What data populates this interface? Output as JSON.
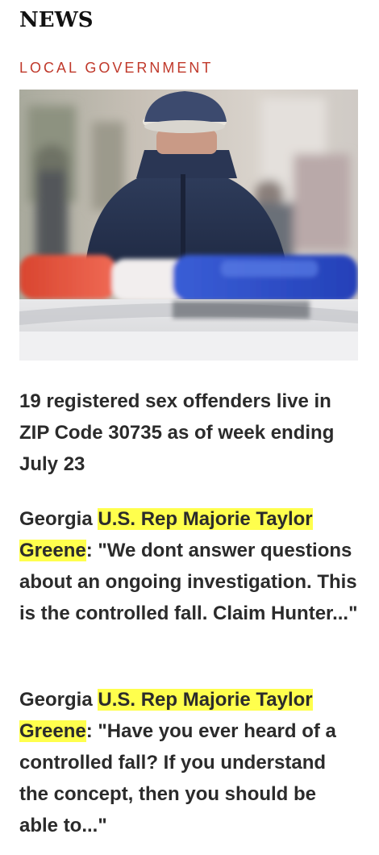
{
  "section": {
    "title": "NEWS",
    "category": "LOCAL GOVERNMENT"
  },
  "hero_image": {
    "icon": "police-officer-lightbar-photo"
  },
  "articles": [
    {
      "headline": "19 registered sex offenders live in ZIP Code 30735 as of week ending July 23"
    },
    {
      "prefix": "Georgia ",
      "highlight": "U.S. Rep Majorie Taylor Greene",
      "suffix": ": \"We dont answer questions about an ongoing investigation. This is the controlled fall. Claim Hunter...\""
    },
    {
      "prefix": "Georgia ",
      "highlight": "U.S. Rep Majorie Taylor Greene",
      "suffix": ": \"Have you ever heard of a controlled fall? If you understand the concept, then you should be able to...\""
    }
  ],
  "colors": {
    "category": "#c0392b",
    "highlight": "#ffff4d",
    "text": "#2b2b2b"
  }
}
